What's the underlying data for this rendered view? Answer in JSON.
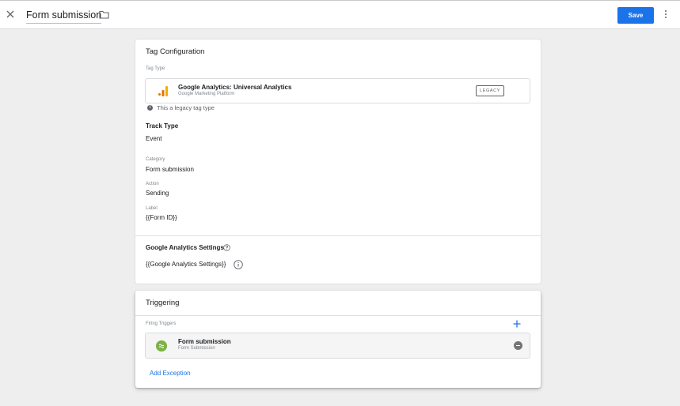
{
  "header": {
    "tag_name": "Form submission",
    "save_label": "Save"
  },
  "config": {
    "title": "Tag Configuration",
    "tag_type_label": "Tag Type",
    "tag_type_name": "Google Analytics: Universal Analytics",
    "tag_type_vendor": "Google Marketing Platform",
    "legacy_badge": "LEGACY",
    "legacy_notice": "This a legacy tag type",
    "track_type_label": "Track Type",
    "track_type_value": "Event",
    "category_label": "Category",
    "category_value": "Form submission",
    "action_label": "Action",
    "action_value": "Sending",
    "label_label": "Label",
    "label_value": "{{Form ID}}",
    "ga_settings_label": "Google Analytics Settings",
    "ga_settings_value": "{{Google Analytics Settings}}"
  },
  "triggering": {
    "title": "Triggering",
    "firing_label": "Firing Triggers",
    "trigger_name": "Form submission",
    "trigger_type": "Form Submission",
    "add_exception": "Add Exception"
  },
  "colors": {
    "accent": "#1a73e8",
    "ga_orange": "#f9ab00",
    "ga_dark_orange": "#e37400",
    "trigger_green": "#7cb342"
  },
  "icons": [
    "close-icon",
    "folder-icon",
    "more-vert-icon",
    "google-analytics-icon",
    "info-icon",
    "help-icon",
    "add-icon",
    "form-trigger-icon",
    "remove-icon"
  ]
}
